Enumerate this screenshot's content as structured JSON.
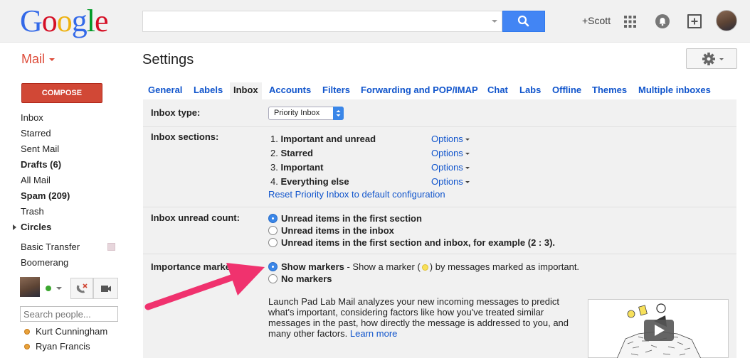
{
  "header": {
    "logo": [
      "G",
      "o",
      "o",
      "g",
      "l",
      "e"
    ],
    "logo_colors": [
      "#3369e8",
      "#d50f25",
      "#eeb211",
      "#3369e8",
      "#009925",
      "#d50f25"
    ],
    "search_value": "",
    "user_link": "+Scott"
  },
  "mail_label": "Mail",
  "page_title": "Settings",
  "compose_label": "COMPOSE",
  "nav": {
    "inbox": "Inbox",
    "starred": "Starred",
    "sent": "Sent Mail",
    "drafts": "Drafts (6)",
    "all_mail": "All Mail",
    "spam": "Spam (209)",
    "trash": "Trash",
    "circles": "Circles",
    "basic_transfer": "Basic Transfer",
    "boomerang": "Boomerang"
  },
  "chat": {
    "search_placeholder": "Search people...",
    "contacts": [
      "Kurt Cunningham",
      "Ryan Francis"
    ]
  },
  "tabs": [
    "General",
    "Labels",
    "Inbox",
    "Accounts",
    "Filters",
    "Forwarding and POP/IMAP",
    "Chat",
    "Labs",
    "Offline",
    "Themes",
    "Multiple inboxes"
  ],
  "settings": {
    "inbox_type_label": "Inbox type:",
    "inbox_type_value": "Priority Inbox",
    "sections_label": "Inbox sections:",
    "sections": [
      {
        "num": "1.",
        "name": "Important and unread",
        "options": "Options"
      },
      {
        "num": "2.",
        "name": "Starred",
        "options": "Options"
      },
      {
        "num": "3.",
        "name": "Important",
        "options": "Options"
      },
      {
        "num": "4.",
        "name": "Everything else",
        "options": "Options"
      }
    ],
    "reset_link": "Reset Priority Inbox to default configuration",
    "unread_label": "Inbox unread count:",
    "unread_options": [
      "Unread items in the first section",
      "Unread items in the inbox",
      "Unread items in the first section and inbox, for example (2 : 3)."
    ],
    "unread_selected": 0,
    "markers_label": "Importance markers:",
    "show_markers": "Show markers",
    "show_markers_desc_a": " - Show a marker (",
    "show_markers_desc_b": ") by messages marked as important.",
    "no_markers": "No markers",
    "markers_selected": 0,
    "description": "Launch Pad Lab Mail analyzes your new incoming messages to predict what's important, considering factors like how you've treated similar messages in the past, how directly the message is addressed to you, and many other factors.",
    "learn_more": "Learn more"
  },
  "colors": {
    "compose": "#d14836",
    "link": "#1155cc",
    "search_button": "#4285f4",
    "annotation_arrow": "#f0326e"
  }
}
